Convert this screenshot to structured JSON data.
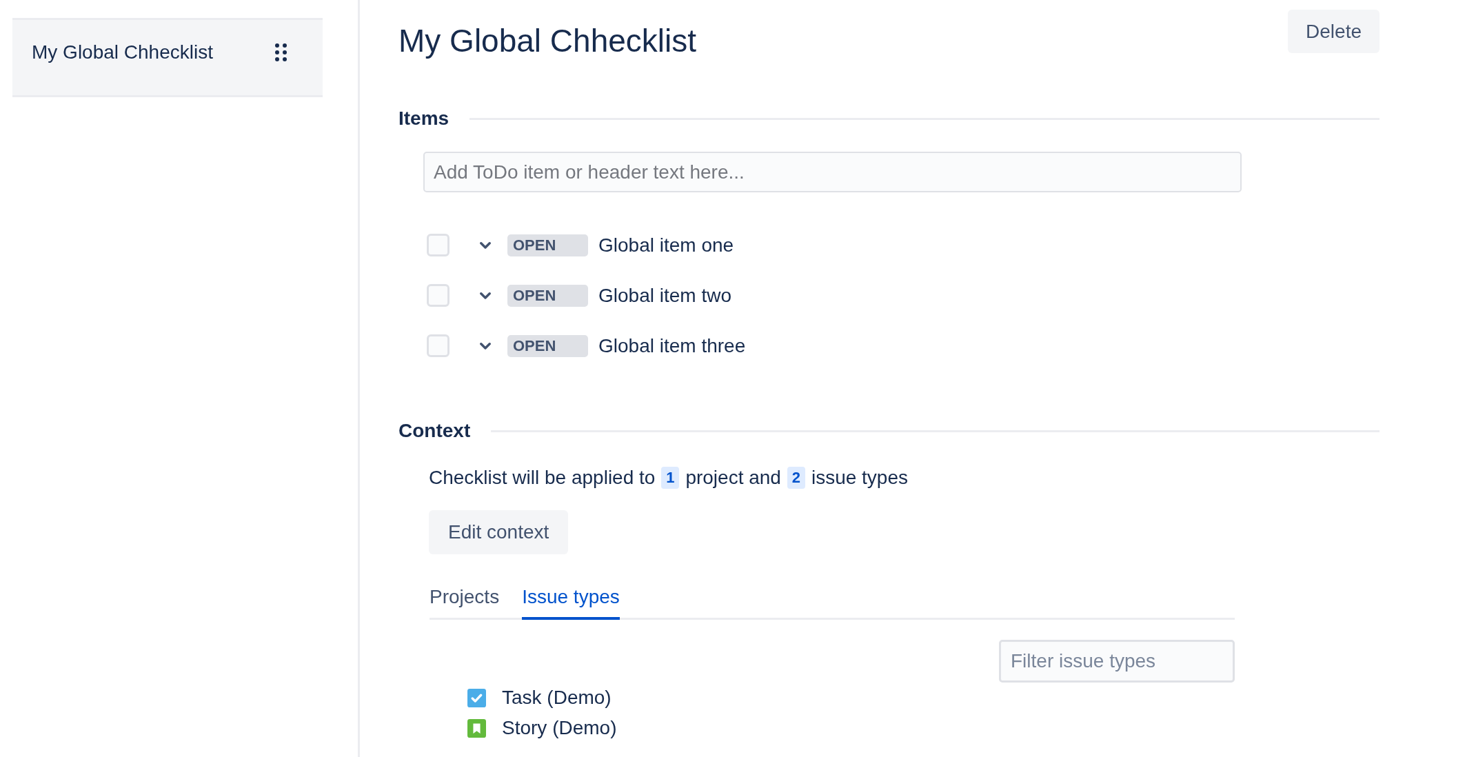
{
  "sidebar": {
    "items": [
      {
        "label": "My Global Chhecklist",
        "selected": true
      }
    ]
  },
  "header": {
    "title": "My Global Chhecklist",
    "delete_button": "Delete"
  },
  "items_section": {
    "heading": "Items",
    "input": {
      "placeholder": "Add ToDo item or header text here..."
    },
    "items": [
      {
        "label": "Global item one",
        "status": "OPEN",
        "checked": false
      },
      {
        "label": "Global item two",
        "status": "OPEN",
        "checked": false
      },
      {
        "label": "Global item three",
        "status": "OPEN",
        "checked": false
      }
    ]
  },
  "context": {
    "heading": "Context",
    "summary": [
      {
        "kind": "text",
        "text": "Checklist will be applied to"
      },
      {
        "kind": "count",
        "text": "1"
      },
      {
        "kind": "text",
        "text": "project and"
      },
      {
        "kind": "count",
        "text": "2"
      },
      {
        "kind": "text",
        "text": "issue types"
      }
    ],
    "edit_button": "Edit context",
    "tabs": [
      {
        "label": "Projects",
        "selected": false
      },
      {
        "label": "Issue types",
        "selected": true
      }
    ],
    "filter": {
      "placeholder": "Filter issue types"
    },
    "issue_types": [
      {
        "label": "Task (Demo)",
        "kind": "task",
        "color": "#4bade8"
      },
      {
        "label": "Story (Demo)",
        "kind": "story",
        "color": "#63ba3c"
      }
    ]
  }
}
